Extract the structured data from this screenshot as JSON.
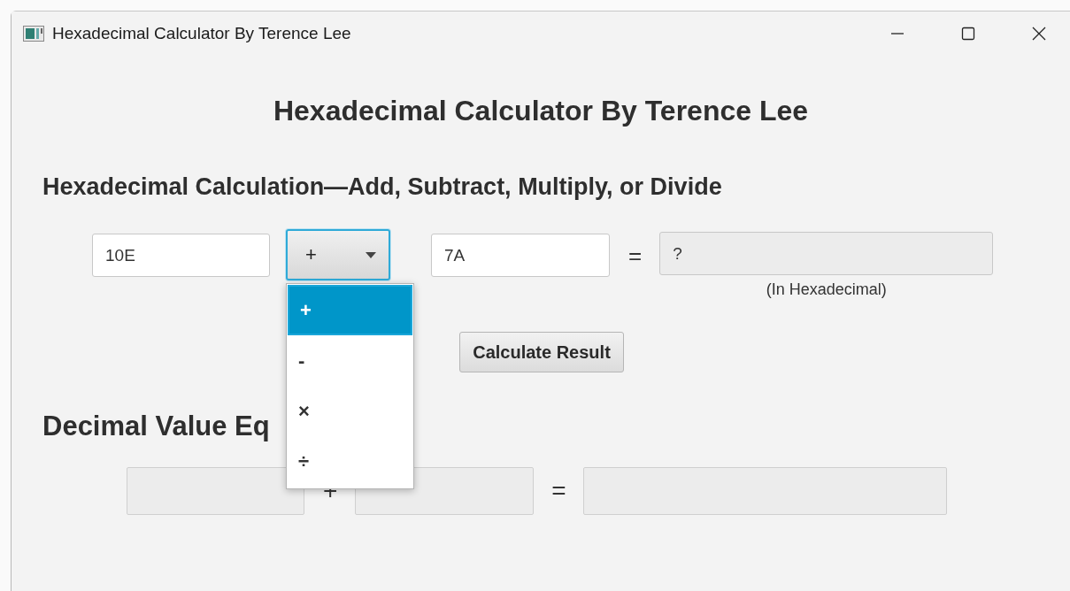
{
  "window": {
    "title": "Hexadecimal Calculator By Terence Lee"
  },
  "heading": "Hexadecimal Calculator By Terence Lee",
  "hex_section": {
    "heading": "Hexadecimal Calculation—Add, Subtract, Multiply, or Divide",
    "operand_1": {
      "value": "10E",
      "readonly": false
    },
    "operator": {
      "value": "+",
      "focused": true,
      "open": true,
      "options": [
        {
          "label": "+",
          "selected": true
        },
        {
          "label": "-",
          "selected": false
        },
        {
          "label": "×",
          "selected": false
        },
        {
          "label": "÷",
          "selected": false
        }
      ]
    },
    "operand_2": {
      "value": "7A",
      "readonly": false
    },
    "equals": "=",
    "result": {
      "value": "?",
      "readonly": true
    },
    "result_note": "(In Hexadecimal)"
  },
  "calculate_button": "Calculate Result",
  "decimal_section": {
    "heading": "Decimal Value Eq",
    "operand_1": {
      "readonly": true
    },
    "operator": "+",
    "operand_2": {
      "readonly": true
    },
    "equals": "=",
    "result": {
      "readonly": true
    }
  }
}
